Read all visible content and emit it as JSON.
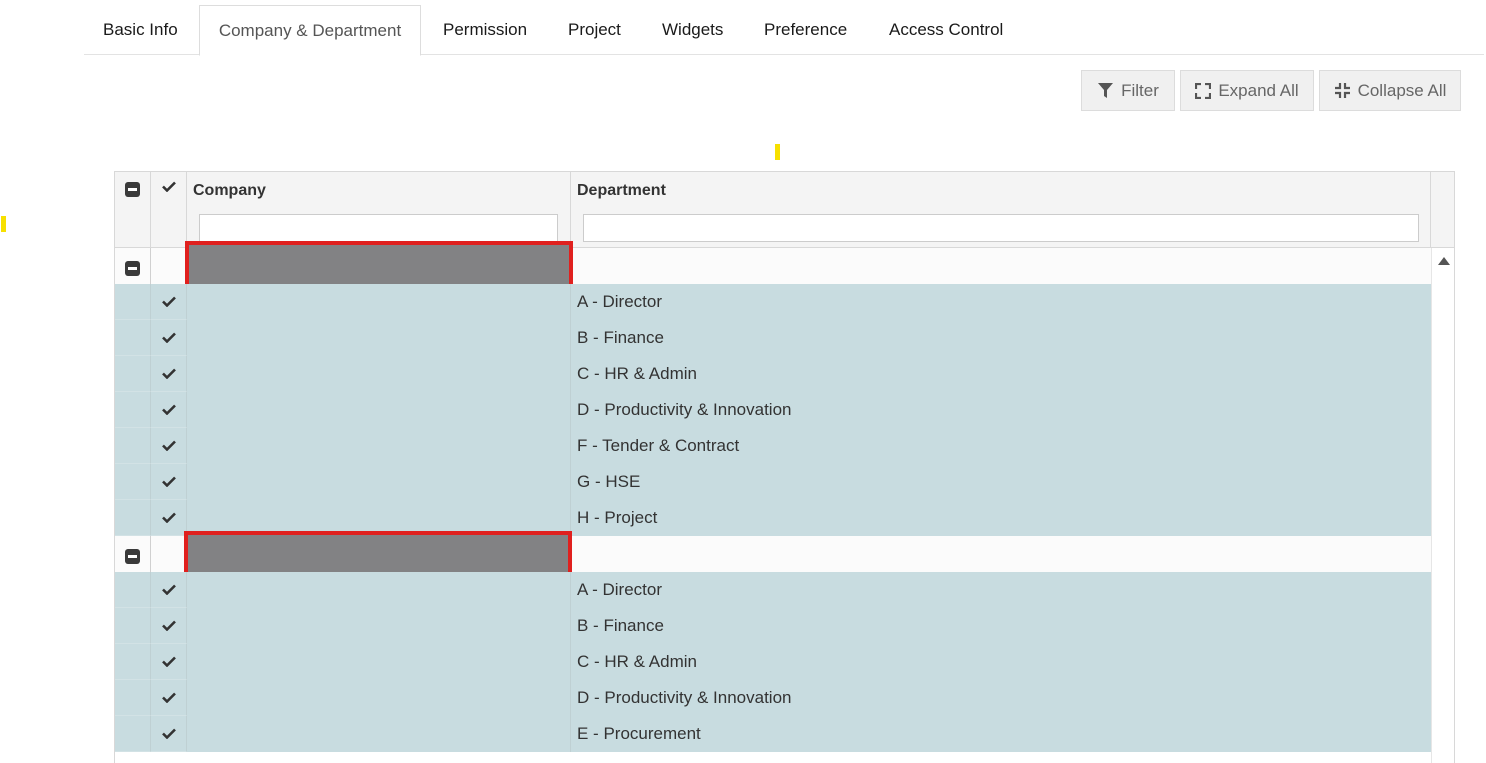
{
  "tabs": [
    {
      "label": "Basic Info",
      "active": false
    },
    {
      "label": "Company & Department",
      "active": true
    },
    {
      "label": "Permission",
      "active": false
    },
    {
      "label": "Project",
      "active": false
    },
    {
      "label": "Widgets",
      "active": false
    },
    {
      "label": "Preference",
      "active": false
    },
    {
      "label": "Access Control",
      "active": false
    }
  ],
  "toolbar": {
    "filter_label": "Filter",
    "expand_label": "Expand All",
    "collapse_label": "Collapse All"
  },
  "grid": {
    "columns": {
      "company": "Company",
      "department": "Department"
    },
    "filters": {
      "company_value": "",
      "department_value": ""
    },
    "groups": [
      {
        "company": "",
        "redacted": true,
        "departments": [
          "A - Director",
          "B - Finance",
          "C - HR & Admin",
          "D - Productivity & Innovation",
          "F - Tender & Contract",
          "G - HSE",
          "H - Project"
        ]
      },
      {
        "company": "",
        "redacted": true,
        "departments": [
          "A - Director",
          "B - Finance",
          "C - HR & Admin",
          "D - Productivity & Innovation",
          "E - Procurement"
        ]
      }
    ]
  },
  "icons": {
    "filter": "filter-icon",
    "expand": "expand-icon",
    "collapse": "collapse-icon",
    "select_all": "check-icon",
    "collapse_group": "minus-square-icon",
    "scroll_up": "caret-up-icon"
  },
  "colors": {
    "selected_row": "#c8dce0",
    "redaction_fill": "#828284",
    "redaction_border": "#e0201e",
    "highlight_marker": "#f7e000"
  }
}
